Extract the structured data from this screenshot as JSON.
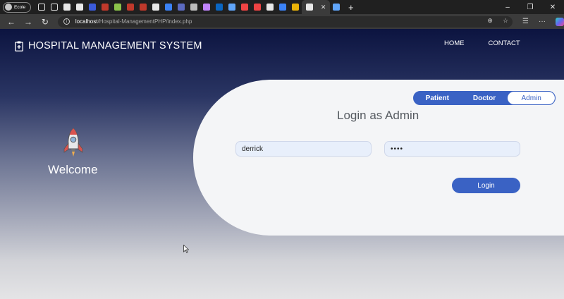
{
  "browser": {
    "profile_label": "Ecole",
    "url_host": "localhost",
    "url_path": "/Hospital-ManagementPHP/index.php",
    "tab_icon_colors": [
      "#e8e8e8",
      "#e8e8e8",
      "#3b5bdb",
      "#c0392b",
      "#8bc34a",
      "#c0392b",
      "#c0392b",
      "#e8e8e8",
      "#3b82f6",
      "#5c6bc0",
      "#bdbdbd",
      "#c084fc",
      "#0a66c2",
      "#60a5fa",
      "#ef4444",
      "#ef4444",
      "#e8e8e8",
      "#3b82f6",
      "#eab308",
      "#e8e8e8",
      "#60a5fa"
    ],
    "active_tab_close": "✕",
    "new_tab": "+",
    "window_controls": [
      "–",
      "❐",
      "✕"
    ]
  },
  "header": {
    "title": "HOSPITAL MANAGEMENT SYSTEM",
    "nav": [
      "HOME",
      "CONTACT"
    ]
  },
  "left_panel": {
    "welcome": "Welcome"
  },
  "login": {
    "roles": [
      "Patient",
      "Doctor",
      "Admin"
    ],
    "selected_role": "Admin",
    "title": "Login as Admin",
    "username_value": "derrick",
    "password_value": "••••",
    "submit_label": "Login"
  },
  "colors": {
    "accent": "#3a62c4"
  }
}
